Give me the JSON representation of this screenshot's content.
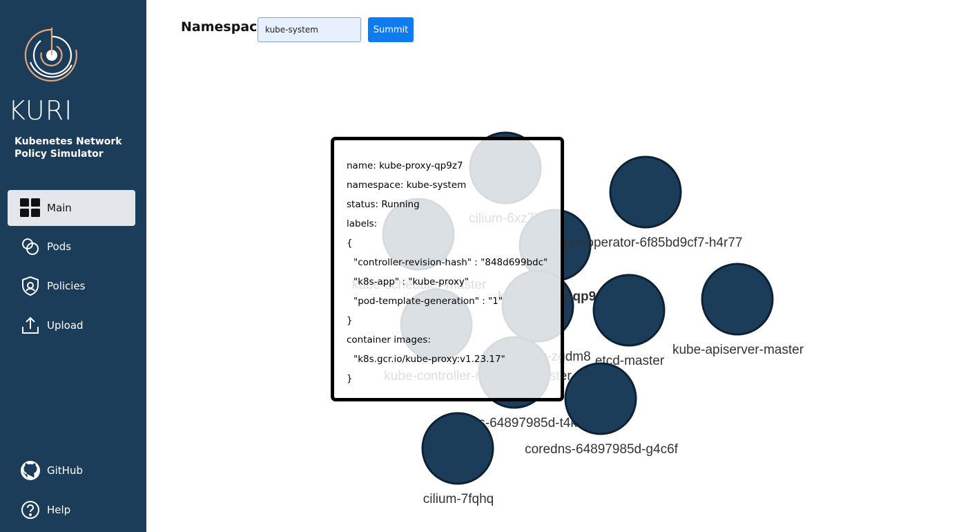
{
  "sidebar": {
    "brand_title": "KURI",
    "brand_subtitle_line1": "Kubenetes Network",
    "brand_subtitle_line2": "Policy Simulator",
    "nav": [
      {
        "label": "Main",
        "icon": "grid-icon",
        "active": true
      },
      {
        "label": "Pods",
        "icon": "pods-icon"
      },
      {
        "label": "Policies",
        "icon": "shield-icon"
      },
      {
        "label": "Upload",
        "icon": "upload-icon"
      }
    ],
    "footer": [
      {
        "label": "GitHub",
        "icon": "github-icon"
      },
      {
        "label": "Help",
        "icon": "help-icon"
      }
    ]
  },
  "toolbar": {
    "namespace_label": "Namespace",
    "namespace_value": "kube-system",
    "submit_label": "Summit"
  },
  "graph": {
    "nodes": [
      {
        "label": "cilium-6xz7b"
      },
      {
        "label": "cilium-operator-6f85bd9cf7-h4r77"
      },
      {
        "label": "kube-scheduler-master"
      },
      {
        "label": "kube-proxy-qp9z7"
      },
      {
        "label": "etcd-master"
      },
      {
        "label": "kube-apiserver-master"
      },
      {
        "label": "kube-proxy-zgdm8"
      },
      {
        "label": "kube-controller-manager-master"
      },
      {
        "label": "coredns-64897985d-t4kzz"
      },
      {
        "label": "coredns-64897985d-g4c6f"
      },
      {
        "label": "cilium-7fqhq"
      }
    ]
  },
  "tooltip": {
    "name": "name: kube-proxy-qp9z7",
    "namespace": "namespace: kube-system",
    "status": "status: Running",
    "labels_header": "labels:",
    "open_brace": "{",
    "label_1": "\"controller-revision-hash\" : \"848d699bdc\"",
    "label_2": "\"k8s-app\" : \"kube-proxy\"",
    "label_3": "\"pod-template-generation\" : \"1\"",
    "close_brace": "}",
    "images_header": "container images:",
    "image_1": "\"k8s.gcr.io/kube-proxy:v1.23.17\"",
    "close_bracket": "}"
  },
  "colors": {
    "sidebar_bg": "#1b3d5a",
    "node_fill": "#1b3d5a",
    "accent_button": "#0d7cf2",
    "logo_orange": "#e8a47a"
  }
}
